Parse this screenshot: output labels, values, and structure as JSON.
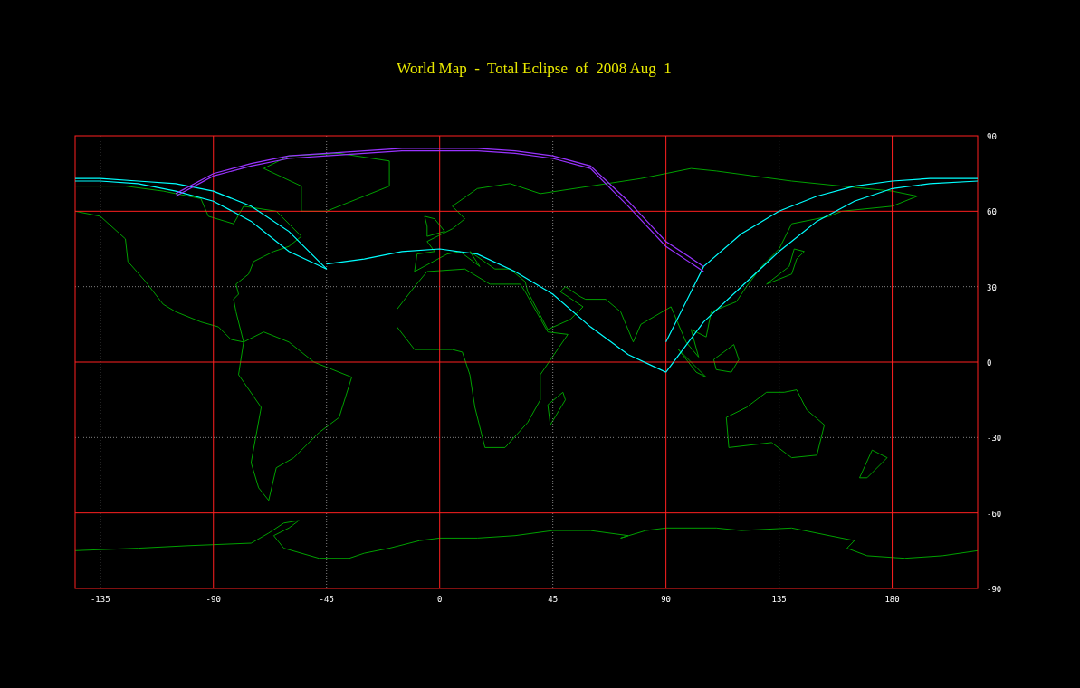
{
  "chart_data": {
    "type": "line",
    "title": "World Map  -  Total Eclipse  of  2008 Aug  1",
    "x": [
      -145,
      -135,
      -120,
      -105,
      -90,
      -75,
      -60,
      -45,
      -30,
      -15,
      0,
      15,
      30,
      45,
      60,
      75,
      90,
      105,
      120,
      135,
      150,
      165,
      180,
      195,
      214
    ],
    "xlim": [
      -145,
      214
    ],
    "ylim": [
      -90,
      90
    ],
    "xticks": [
      -135,
      -90,
      -45,
      0,
      45,
      90,
      135,
      180
    ],
    "yticks": [
      90,
      60,
      30,
      0,
      -30,
      -60,
      -90
    ],
    "grid": true,
    "series": [
      {
        "color": "#00ffff",
        "values": [
          null,
          null,
          null,
          null,
          null,
          null,
          null,
          39,
          41,
          44,
          45,
          43,
          36,
          27,
          14,
          3,
          -4,
          null,
          null,
          null,
          null,
          null,
          null,
          null,
          null
        ]
      },
      {
        "color": "#00ffff",
        "values": [
          null,
          null,
          null,
          null,
          null,
          null,
          null,
          null,
          null,
          null,
          null,
          null,
          null,
          null,
          null,
          null,
          -4,
          16,
          30,
          44,
          56,
          64,
          69,
          71,
          72
        ]
      },
      {
        "color": "#00ffff",
        "values": [
          null,
          null,
          null,
          null,
          null,
          null,
          null,
          null,
          null,
          null,
          null,
          null,
          null,
          null,
          null,
          null,
          8,
          38,
          51,
          60,
          66,
          70,
          72,
          73,
          73
        ]
      },
      {
        "color": "#00ffff",
        "values": [
          72,
          72,
          71,
          68,
          64,
          56,
          44,
          37,
          null,
          null,
          null,
          null,
          null,
          null,
          null,
          null,
          null,
          null,
          null,
          null,
          null,
          null,
          null,
          null,
          null
        ]
      },
      {
        "color": "#00ffff",
        "values": [
          73,
          73,
          72,
          71,
          68,
          62,
          52,
          37,
          null,
          null,
          null,
          null,
          null,
          null,
          null,
          null,
          null,
          null,
          null,
          null,
          null,
          null,
          null,
          null,
          null
        ]
      },
      {
        "color": "#9933ff",
        "values": [
          null,
          null,
          null,
          67,
          75,
          79,
          82,
          83,
          84,
          85,
          85,
          85,
          84,
          82,
          78,
          64,
          48,
          38,
          null,
          null,
          null,
          null,
          null,
          null,
          null
        ]
      },
      {
        "color": "#9933ff",
        "values": [
          null,
          null,
          null,
          66,
          74,
          78,
          81,
          82,
          83,
          84,
          84,
          84,
          83,
          81,
          77,
          62,
          46,
          36,
          null,
          null,
          null,
          null,
          null,
          null,
          null
        ]
      }
    ]
  }
}
